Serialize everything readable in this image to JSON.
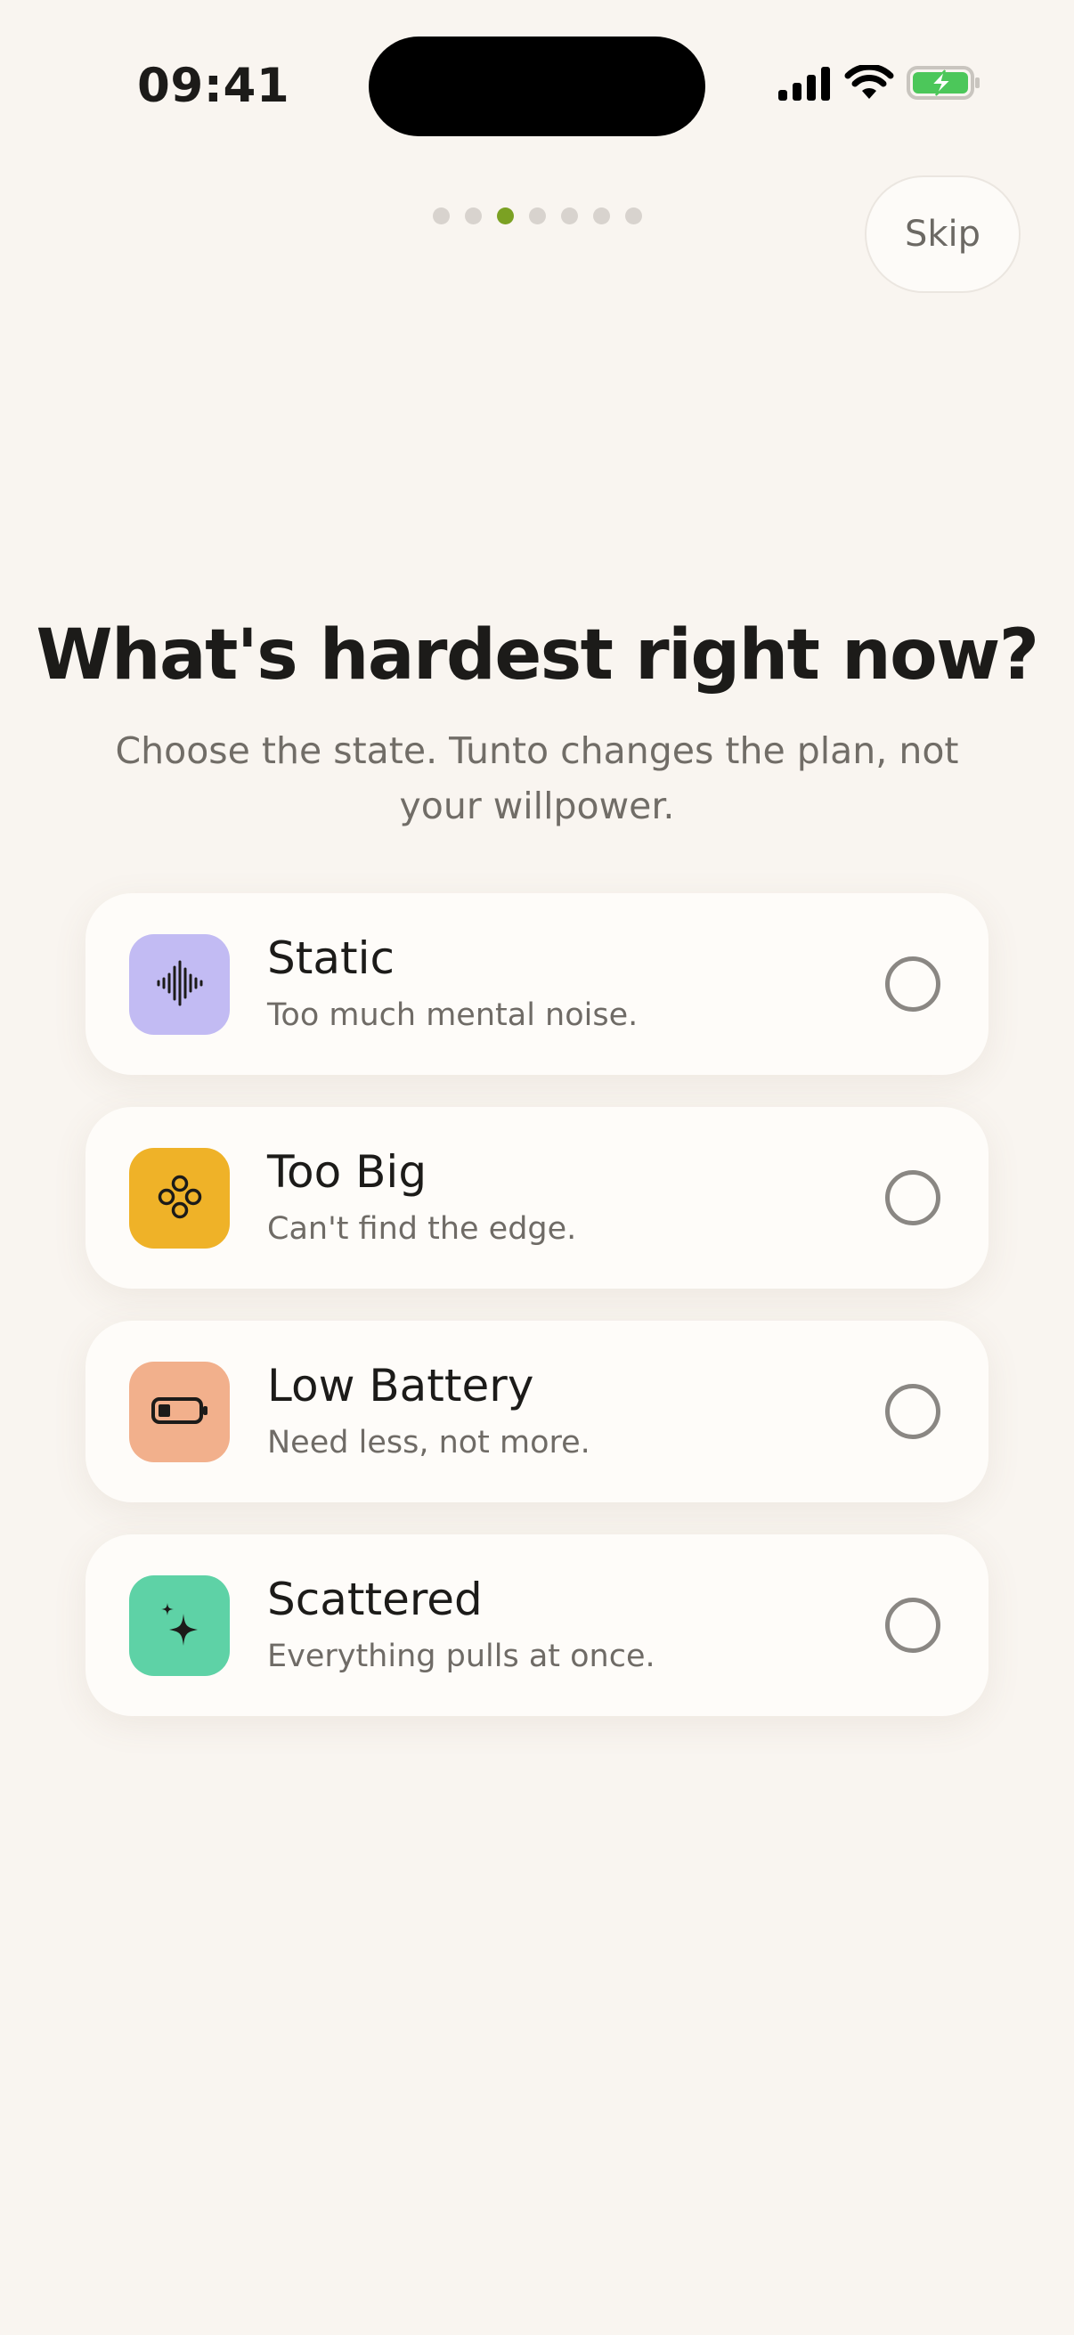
{
  "status_bar": {
    "time": "09:41"
  },
  "progress": {
    "total_steps": 7,
    "current_step": 3,
    "active_color": "#7ba123"
  },
  "header": {
    "skip_label": "Skip"
  },
  "main": {
    "title": "What's hardest right now?",
    "subtitle": "Choose the state. Tunto changes the plan, not your willpower."
  },
  "options": [
    {
      "title": "Static",
      "description": "Too much mental noise.",
      "icon": "waveform-icon",
      "icon_bg": "#c2bbf3",
      "selected": false
    },
    {
      "title": "Too Big",
      "description": "Can't find the edge.",
      "icon": "four-circles-icon",
      "icon_bg": "#efb228",
      "selected": false
    },
    {
      "title": "Low Battery",
      "description": "Need less, not more.",
      "icon": "low-battery-icon",
      "icon_bg": "#f2b08c",
      "selected": false
    },
    {
      "title": "Scattered",
      "description": "Everything pulls at once.",
      "icon": "sparkle-icon",
      "icon_bg": "#5ed2a6",
      "selected": false
    }
  ]
}
